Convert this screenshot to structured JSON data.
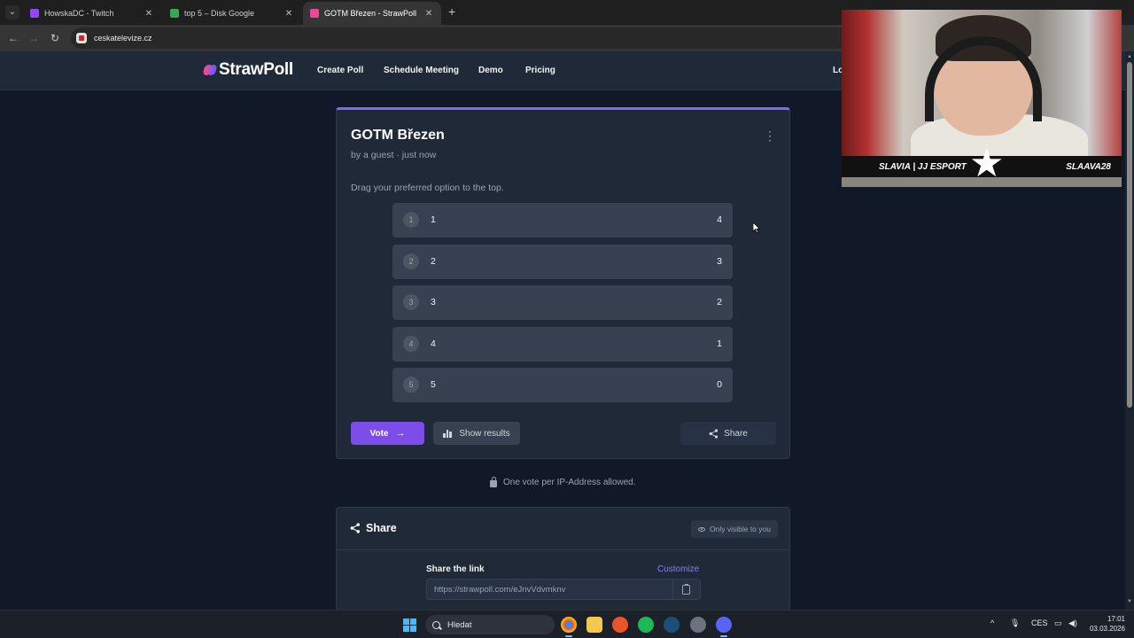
{
  "browser": {
    "tabs": [
      {
        "title": "HowskaDC - Twitch",
        "favicon_color": "#9146ff",
        "active": false
      },
      {
        "title": "top 5 – Disk Google",
        "favicon_color": "#34a853",
        "active": false
      },
      {
        "title": "GOTM Březen - StrawPoll",
        "favicon_color": "#ec4899",
        "active": true
      }
    ],
    "new_tab_label": "+",
    "address": "ceskatelevize.cz"
  },
  "header": {
    "logo": "StrawPoll",
    "nav": [
      "Create Poll",
      "Schedule Meeting",
      "Demo",
      "Pricing"
    ],
    "login": "Login"
  },
  "poll": {
    "title": "GOTM Březen",
    "meta": "by a guest · just now",
    "instruction": "Drag your preferred option to the top.",
    "options": [
      {
        "rank": "1",
        "label": "1",
        "votes": "4"
      },
      {
        "rank": "2",
        "label": "2",
        "votes": "3"
      },
      {
        "rank": "3",
        "label": "3",
        "votes": "2"
      },
      {
        "rank": "4",
        "label": "4",
        "votes": "1"
      },
      {
        "rank": "5",
        "label": "5",
        "votes": "0"
      }
    ],
    "vote_label": "Vote",
    "show_results_label": "Show results",
    "share_label": "Share",
    "ip_note": "One vote per IP-Address allowed."
  },
  "share_panel": {
    "title": "Share",
    "visibility": "Only visible to you",
    "link_label": "Share the link",
    "customize_label": "Customize",
    "link_value": "https://strawpoll.com/eJnvVdvmknv"
  },
  "webcam": {
    "left_caption": "SLAVIA | JJ ESPORT",
    "right_caption": "SLAAVA28"
  },
  "taskbar": {
    "search_placeholder": "Hledat",
    "language": "CES",
    "time": "17:01",
    "date": "03.03.2026"
  },
  "colors": {
    "page_bg": "#111827",
    "card_bg": "#1f2937",
    "accent": "#7c4de8",
    "card_top_border": "#7c6cf0"
  }
}
